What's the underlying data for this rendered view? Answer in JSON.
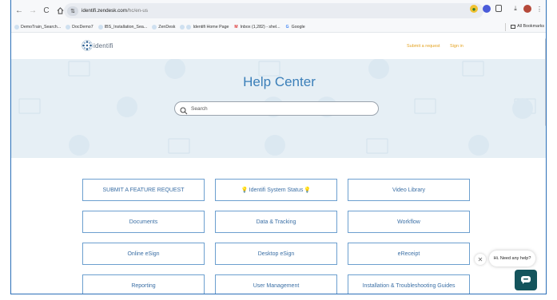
{
  "browser": {
    "url_domain": "identifi.zendesk.com",
    "url_path": "/hc/en-us",
    "bookmarks": [
      {
        "label": "DemoTrain_Search..."
      },
      {
        "label": "DocDemo7"
      },
      {
        "label": "IBS_Installation_Sea..."
      },
      {
        "label": "ZenDesk"
      },
      {
        "label": "Identifi Home Page"
      },
      {
        "label": "Inbox (1,282) - shel..."
      },
      {
        "label": "Google"
      }
    ],
    "all_bookmarks": "All Bookmarks"
  },
  "header": {
    "logo_text": "identifi",
    "submit_request": "Submit a request",
    "sign_in": "Sign in"
  },
  "hero": {
    "title": "Help Center",
    "search_placeholder": "Search"
  },
  "categories": [
    {
      "label": "SUBMIT A FEATURE REQUEST"
    },
    {
      "label": "Identifi System Status"
    },
    {
      "label": "Video Library"
    },
    {
      "label": "Documents"
    },
    {
      "label": "Data & Tracking"
    },
    {
      "label": "Workflow"
    },
    {
      "label": "Online eSign"
    },
    {
      "label": "Desktop eSign"
    },
    {
      "label": "eReceipt"
    },
    {
      "label": "Reporting"
    },
    {
      "label": "User Management"
    },
    {
      "label": "Installation & Troubleshooting Guides"
    }
  ],
  "help_widget": {
    "bubble_text": "Hi. Need any help?"
  },
  "colors": {
    "frame": "#2a6fb8",
    "hero_bg": "#e6eff5",
    "title_blue": "#3b7fb9",
    "link_orange": "#e4a21f",
    "card_border": "#6c9fcf",
    "widget": "#14545c"
  }
}
